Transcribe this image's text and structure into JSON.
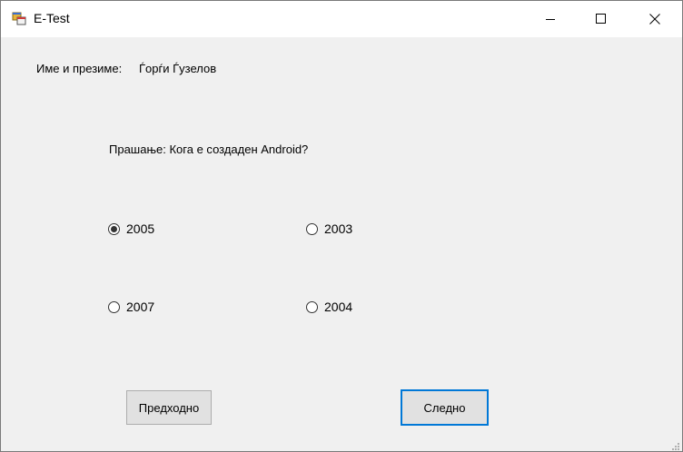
{
  "window": {
    "title": "E-Test",
    "app_icon": "windows-forms-app-icon",
    "controls": [
      "minimize-icon",
      "maximize-icon",
      "close-icon"
    ]
  },
  "form": {
    "name_label": "Име и презиме:",
    "name_value": "Ѓорѓи Ѓузелов",
    "question": "Прашање: Кога е создаден Android?",
    "options": [
      {
        "label": "2005",
        "checked": true
      },
      {
        "label": "2003",
        "checked": false
      },
      {
        "label": "2007",
        "checked": false
      },
      {
        "label": "2004",
        "checked": false
      }
    ],
    "prev_button": "Предходно",
    "next_button": "Следно"
  },
  "colors": {
    "background": "#f0f0f0",
    "titlebar": "#ffffff",
    "focus_border": "#0078d7",
    "button_face": "#e1e1e1"
  }
}
